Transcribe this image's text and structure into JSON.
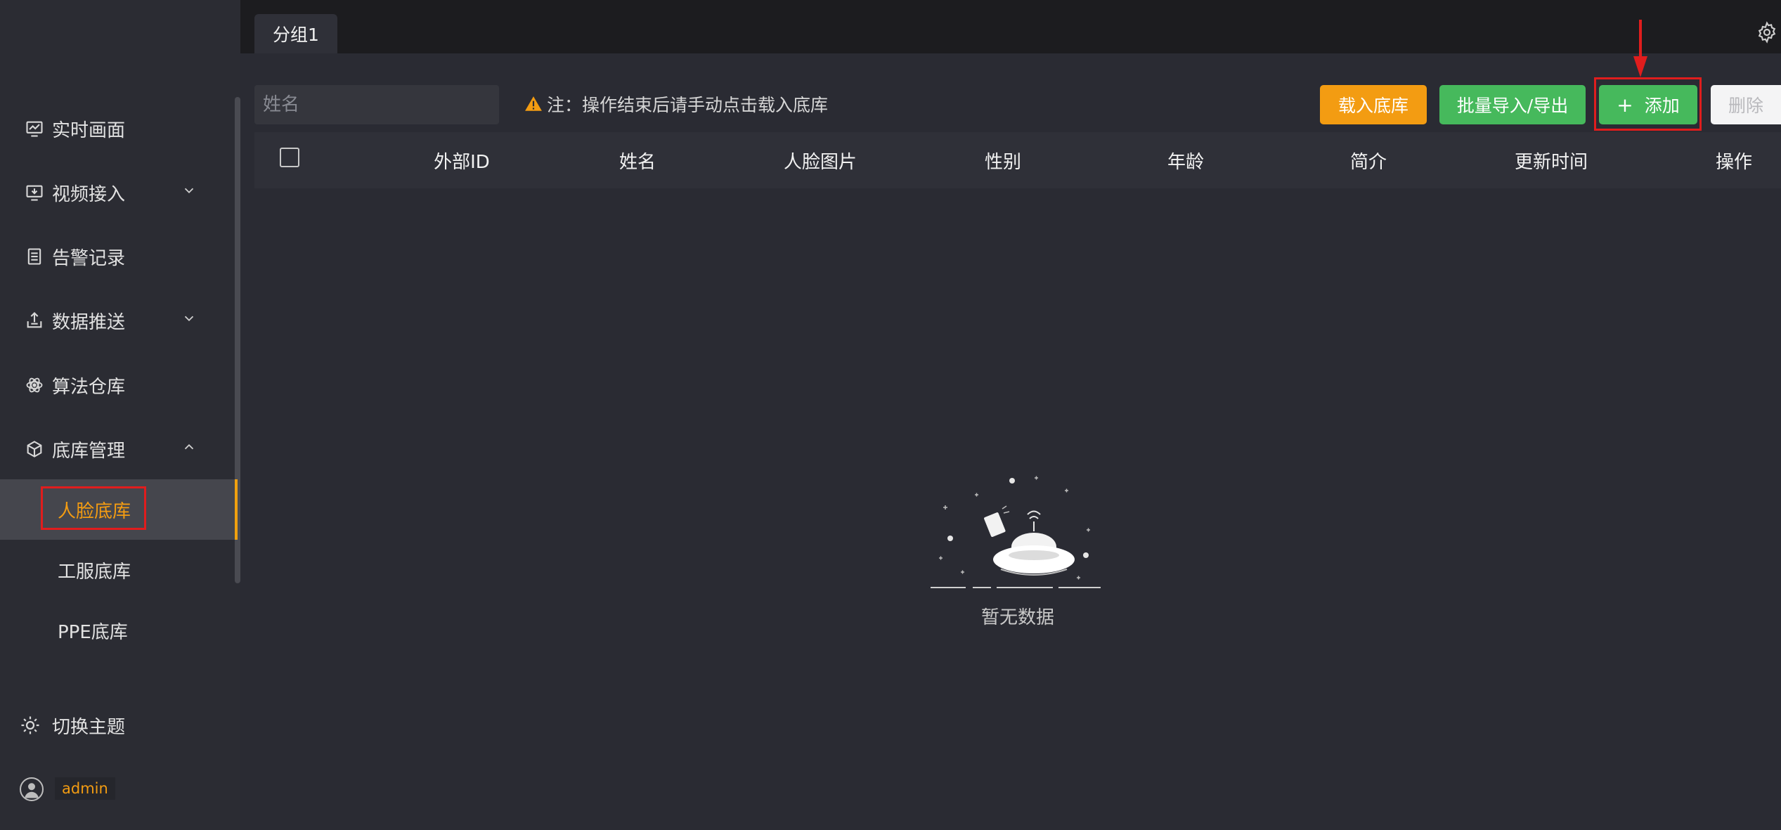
{
  "sidebar": {
    "items": [
      {
        "label": "实时画面",
        "icon": "monitor-chart-icon",
        "expandable": false
      },
      {
        "label": "视频接入",
        "icon": "video-input-icon",
        "expandable": true,
        "expanded": false
      },
      {
        "label": "告警记录",
        "icon": "document-list-icon",
        "expandable": false
      },
      {
        "label": "数据推送",
        "icon": "upload-tray-icon",
        "expandable": true,
        "expanded": false
      },
      {
        "label": "算法仓库",
        "icon": "atom-icon",
        "expandable": false
      },
      {
        "label": "底库管理",
        "icon": "cube-icon",
        "expandable": true,
        "expanded": true
      }
    ],
    "sub_items": [
      {
        "label": "人脸底库",
        "active": true
      },
      {
        "label": "工服底库",
        "active": false
      },
      {
        "label": "PPE底库",
        "active": false
      }
    ],
    "theme_label": "切换主题",
    "user": "admin"
  },
  "tabs": [
    {
      "label": "分组1",
      "active": true
    }
  ],
  "toolbar": {
    "search_placeholder": "姓名",
    "note": "注：操作结束后请手动点击载入底库",
    "load_label": "载入底库",
    "batch_label": "批量导入/导出",
    "add_label": "添加",
    "delete_label": "删除"
  },
  "table": {
    "columns": [
      "外部ID",
      "姓名",
      "人脸图片",
      "性别",
      "年龄",
      "简介",
      "更新时间",
      "操作"
    ],
    "rows": [],
    "empty_text": "暂无数据"
  },
  "colors": {
    "accent_orange": "#f39c12",
    "accent_green": "#46b95c",
    "highlight_red": "#e01d1d",
    "bg_dark": "#2a2b33"
  }
}
